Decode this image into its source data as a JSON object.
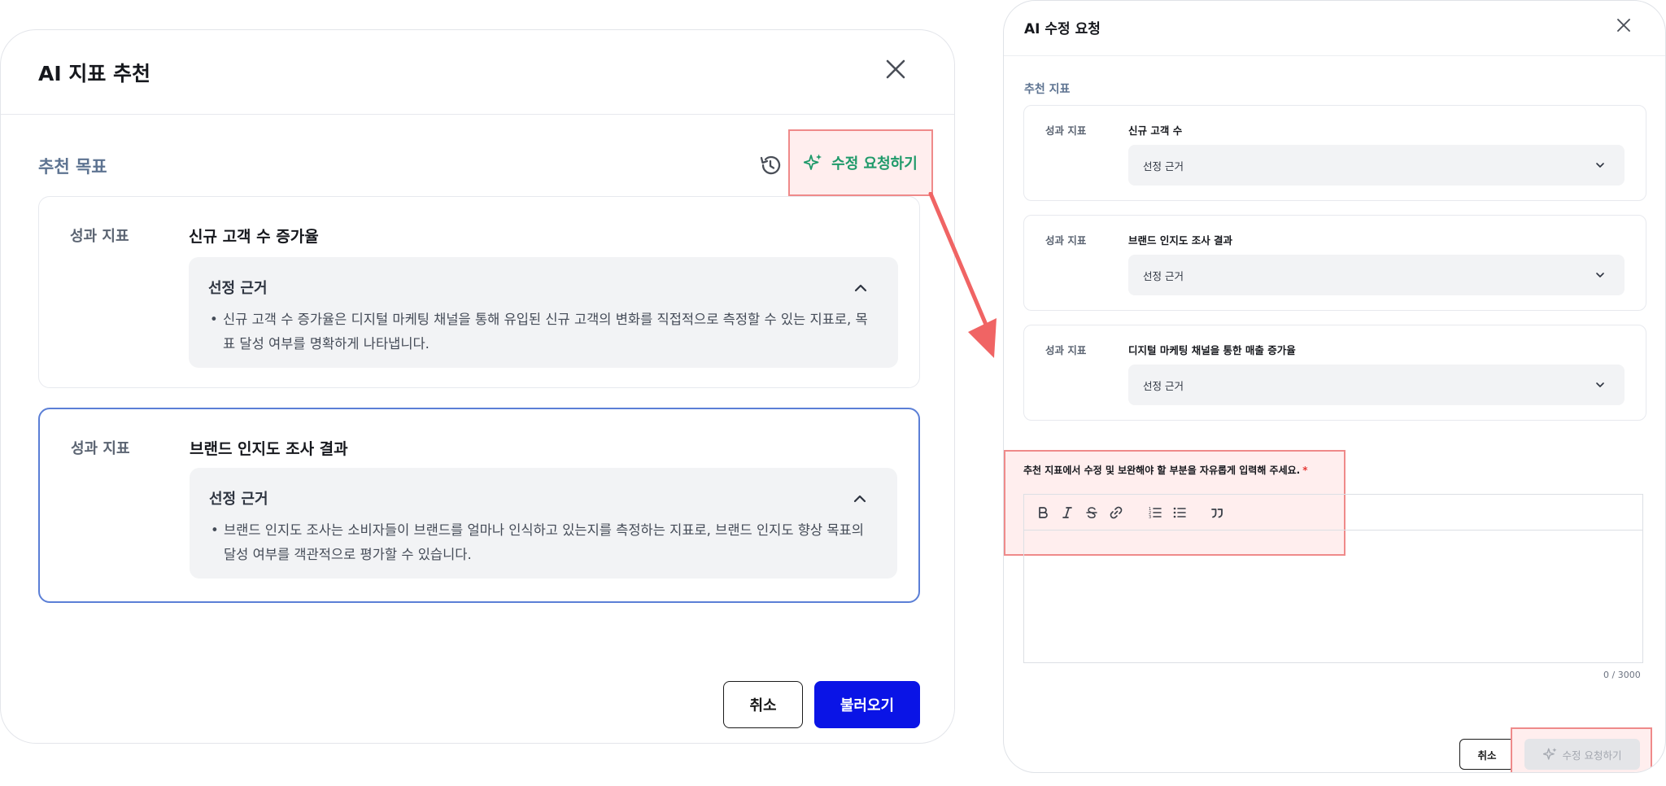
{
  "left_modal": {
    "title": "AI 지표 추천",
    "section_title": "추천 목표",
    "edit_request_label": "수정 요청하기",
    "cards": [
      {
        "label": "성과 지표",
        "name": "신규 고객 수 증가율",
        "reason_title": "선정 근거",
        "reason_text": "신규 고객 수 증가율은 디지털 마케팅 채널을 통해 유입된 신규 고객의 변화를 직접적으로 측정할 수 있는 지표로, 목표 달성 여부를 명확하게 나타냅니다."
      },
      {
        "label": "성과 지표",
        "name": "브랜드 인지도 조사 결과",
        "reason_title": "선정 근거",
        "reason_text": "브랜드 인지도 조사는 소비자들이 브랜드를 얼마나 인식하고 있는지를 측정하는 지표로, 브랜드 인지도 향상 목표의 달성 여부를 객관적으로 평가할 수 있습니다."
      }
    ],
    "cancel_label": "취소",
    "load_label": "불러오기"
  },
  "right_panel": {
    "title": "AI 수정 요청",
    "section_title": "추천 지표",
    "cards": [
      {
        "label": "성과 지표",
        "name": "신규 고객 수",
        "select_label": "선정 근거"
      },
      {
        "label": "성과 지표",
        "name": "브랜드 인지도 조사 결과",
        "select_label": "선정 근거"
      },
      {
        "label": "성과 지표",
        "name": "디지털 마케팅 채널을 통한 매출 증가율",
        "select_label": "선정 근거"
      }
    ],
    "prompt": "추천 지표에서 수정 및 보완해야 할 부분을 자유롭게 입력해 주세요.",
    "required_mark": "*",
    "counter": "0 / 3000",
    "cancel_label": "취소",
    "submit_label": "수정 요청하기"
  },
  "colors": {
    "primary": "#0a14e6",
    "accent_green": "#1f9a6a",
    "highlight_border": "#ef8a8a",
    "highlight_fill": "#ffeeee",
    "selected_border": "#5b7fd6",
    "arrow": "#f06464"
  }
}
